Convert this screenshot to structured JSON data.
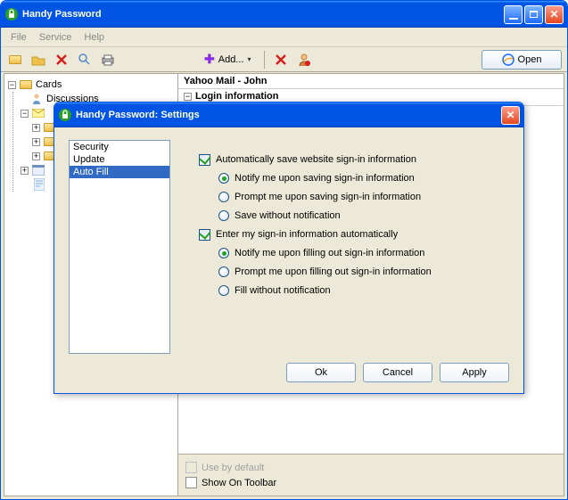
{
  "window": {
    "title": "Handy Password"
  },
  "menubar": {
    "file": "File",
    "service": "Service",
    "help": "Help"
  },
  "toolbar": {
    "add_label": "Add...",
    "open_label": "Open"
  },
  "tree": {
    "root": "Cards",
    "discussions": "Discussions"
  },
  "detail": {
    "title": "Yahoo Mail - John",
    "login_info": "Login information",
    "use_by_default": "Use by default",
    "show_on_toolbar": "Show On Toolbar"
  },
  "dialog": {
    "title": "Handy Password: Settings",
    "categories": {
      "security": "Security",
      "update": "Update",
      "autofill": "Auto Fill"
    },
    "opts": {
      "auto_save": "Automatically save website sign-in information",
      "save_notify": "Notify me upon saving sign-in information",
      "save_prompt": "Prompt me upon saving sign-in information",
      "save_silent": "Save without notification",
      "auto_enter": "Enter my sign-in information automatically",
      "fill_notify": "Notify me upon filling out sign-in information",
      "fill_prompt": "Prompt me upon filling out sign-in information",
      "fill_silent": "Fill without notification"
    },
    "buttons": {
      "ok": "Ok",
      "cancel": "Cancel",
      "apply": "Apply"
    }
  }
}
